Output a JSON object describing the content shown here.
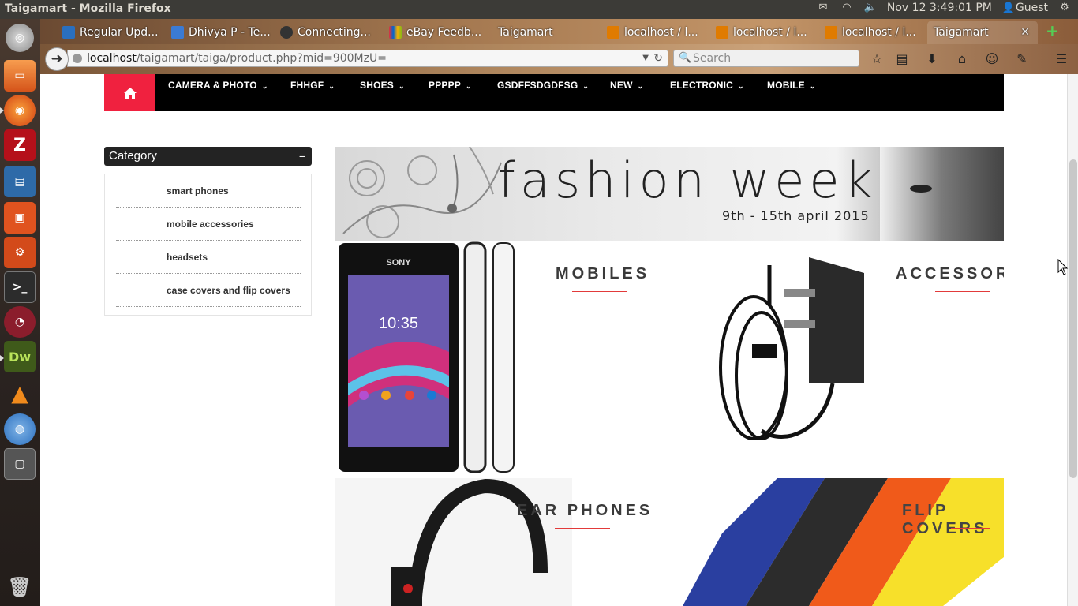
{
  "panel": {
    "window_title": "Taigamart - Mozilla Firefox",
    "clock": "Nov 12  3:49:01 PM",
    "user": "Guest"
  },
  "tabs": [
    {
      "label": "Regular Upd...",
      "color": "#2a6fbf"
    },
    {
      "label": "Dhivya P - Te...",
      "color": "#3b7bd4"
    },
    {
      "label": "Connecting...",
      "color": "#333333"
    },
    {
      "label": "eBay Feedb...",
      "color": "#d4a017"
    },
    {
      "label": "Taigamart",
      "color": ""
    },
    {
      "label": "localhost / l...",
      "color": "#e07b00"
    },
    {
      "label": "localhost / l...",
      "color": "#e07b00"
    },
    {
      "label": "localhost / l...",
      "color": "#e07b00"
    },
    {
      "label": "Taigamart",
      "color": ""
    }
  ],
  "urlbar": {
    "host": "localhost",
    "path": "/taigamart/taiga/product.php?mid=900MzU="
  },
  "searchbar": {
    "placeholder": "Search"
  },
  "site": {
    "nav_items": [
      "CAMERA & PHOTO",
      "FHHGF",
      "SHOES",
      "PPPPP",
      "GSDFFSDGDFSG",
      "NEW",
      "ELECTRONIC",
      "MOBILE"
    ],
    "category_title": "Category",
    "category_toggle": "−",
    "categories": [
      "smart phones",
      "mobile accessories",
      "headsets",
      "case covers and flip covers"
    ],
    "banner_title": "fashion week",
    "banner_date": "9th - 15th april 2015",
    "tiles": {
      "mobiles": "MOBILES",
      "accessories": "ACCESSORIES",
      "ear_phones": "EAR PHONES",
      "flip_covers": "FLIP COVERS"
    },
    "phone": {
      "brand": "SONY",
      "time": "10:35"
    }
  },
  "colors": {
    "accent": "#f0213f",
    "nav_bg": "#000000",
    "underline": "#e23a3a"
  }
}
